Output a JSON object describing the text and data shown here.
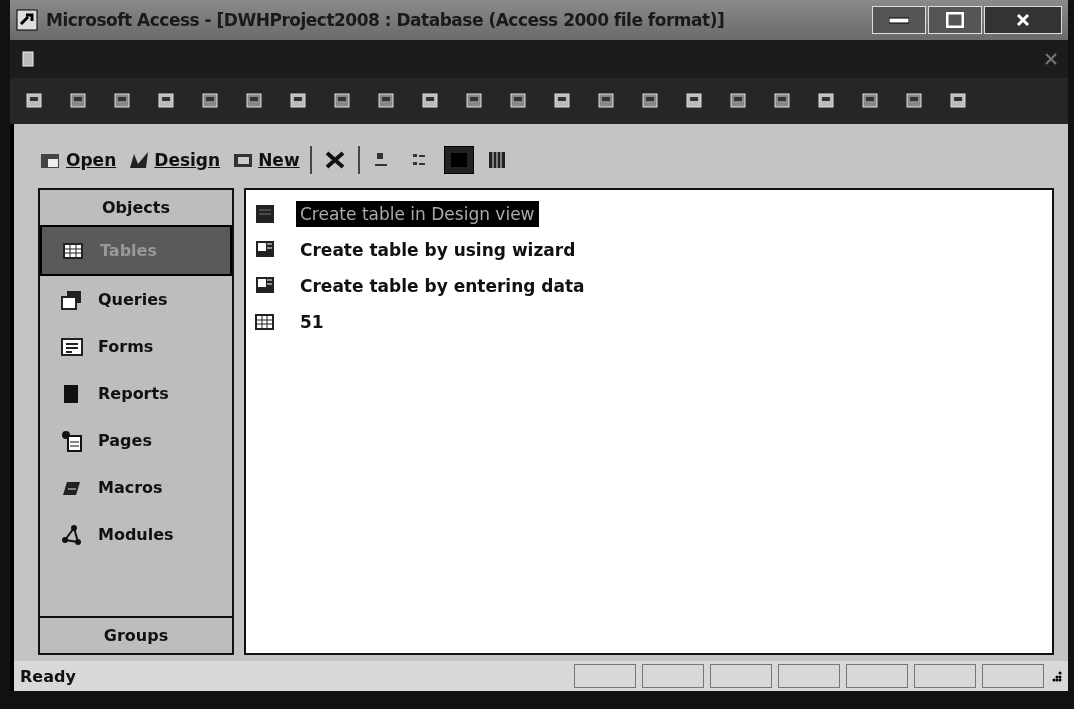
{
  "window": {
    "title": "Microsoft Access - [DWHProject2008 : Database (Access 2000 file format)]"
  },
  "db_toolbar": {
    "buttons": [
      {
        "label": "Open",
        "kind": "open"
      },
      {
        "label": "Design",
        "kind": "design"
      },
      {
        "label": "New",
        "kind": "new"
      }
    ],
    "views": [
      {
        "kind": "large",
        "selected": false
      },
      {
        "kind": "small",
        "selected": false
      },
      {
        "kind": "list",
        "selected": true
      },
      {
        "kind": "details",
        "selected": false
      }
    ]
  },
  "sidebar": {
    "header": "Objects",
    "items": [
      {
        "label": "Tables",
        "kind": "tables",
        "selected": true
      },
      {
        "label": "Queries",
        "kind": "queries",
        "selected": false
      },
      {
        "label": "Forms",
        "kind": "forms",
        "selected": false
      },
      {
        "label": "Reports",
        "kind": "reports",
        "selected": false
      },
      {
        "label": "Pages",
        "kind": "pages",
        "selected": false
      },
      {
        "label": "Macros",
        "kind": "macros",
        "selected": false
      },
      {
        "label": "Modules",
        "kind": "modules",
        "selected": false
      }
    ],
    "footer": "Groups"
  },
  "objects": [
    {
      "label": "Create table in Design view",
      "kind": "design",
      "selected": true
    },
    {
      "label": "Create table by using wizard",
      "kind": "wizard",
      "selected": false
    },
    {
      "label": "Create table by entering data",
      "kind": "wizard",
      "selected": false
    },
    {
      "label": "51",
      "kind": "table",
      "selected": false
    }
  ],
  "status_bar": {
    "text": "Ready"
  }
}
